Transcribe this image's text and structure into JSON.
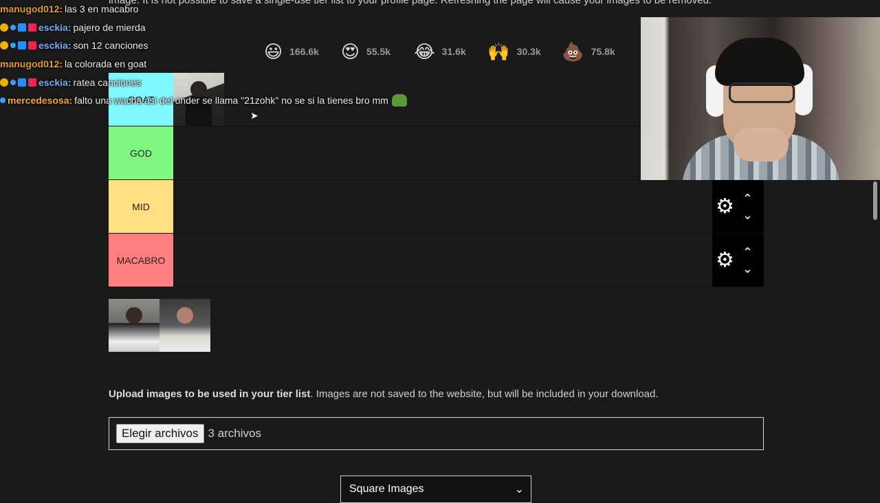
{
  "notice": "image. It is not possible to save a single-use tier list to your profile page. Refreshing the page will cause your images to be removed.",
  "reactions": [
    {
      "icon": "grinning-face",
      "glyph": "😃",
      "count": "166.6k"
    },
    {
      "icon": "heart-eyes",
      "glyph": "😍",
      "count": "55.5k"
    },
    {
      "icon": "tears-of-joy",
      "glyph": "😂",
      "count": "31.6k"
    },
    {
      "icon": "raised-hands",
      "glyph": "🙌",
      "count": "30.3k"
    },
    {
      "icon": "pile-of-poo",
      "glyph": "💩",
      "count": "75.8k"
    }
  ],
  "tiers": [
    {
      "label": "GOAT",
      "color": "#7ff9ff"
    },
    {
      "label": "GOD",
      "color": "#7ff97f"
    },
    {
      "label": "MID",
      "color": "#ffdf7f"
    },
    {
      "label": "MACABRO",
      "color": "#ff7f7f"
    }
  ],
  "controls": {
    "settings_icon": "gear-icon",
    "up_glyph": "⌃",
    "down_glyph": "⌄"
  },
  "upload": {
    "bold": "Upload images to be used in your tier list",
    "rest": ". Images are not saved to the website, but will be included in your download.",
    "button": "Elegir archivos",
    "count": "3 archivos"
  },
  "select": {
    "value": "Square Images"
  },
  "chat": [
    {
      "user": "manugod012",
      "color": "orange",
      "badges": [],
      "text": "las 3 en macabro"
    },
    {
      "user": "esckia",
      "color": "blue",
      "badges": [
        "b1",
        "b2",
        "b3",
        "b4"
      ],
      "text": "pajero de mierda"
    },
    {
      "user": "esckia",
      "color": "blue",
      "badges": [
        "b1",
        "b2",
        "b3",
        "b4"
      ],
      "text": "son 12 canciones"
    },
    {
      "user": "manugod012",
      "color": "orange",
      "badges": [],
      "text": "la colorada en goat"
    },
    {
      "user": "esckia",
      "color": "blue",
      "badges": [
        "b1",
        "b2",
        "b3",
        "b4"
      ],
      "text": "ratea canciones"
    },
    {
      "user": "mercedesosa",
      "color": "gold",
      "badges": [
        "b2"
      ],
      "text": "falto una wacha asi del under se llama \"21zohk\" no se si la tienes bro mm"
    }
  ]
}
